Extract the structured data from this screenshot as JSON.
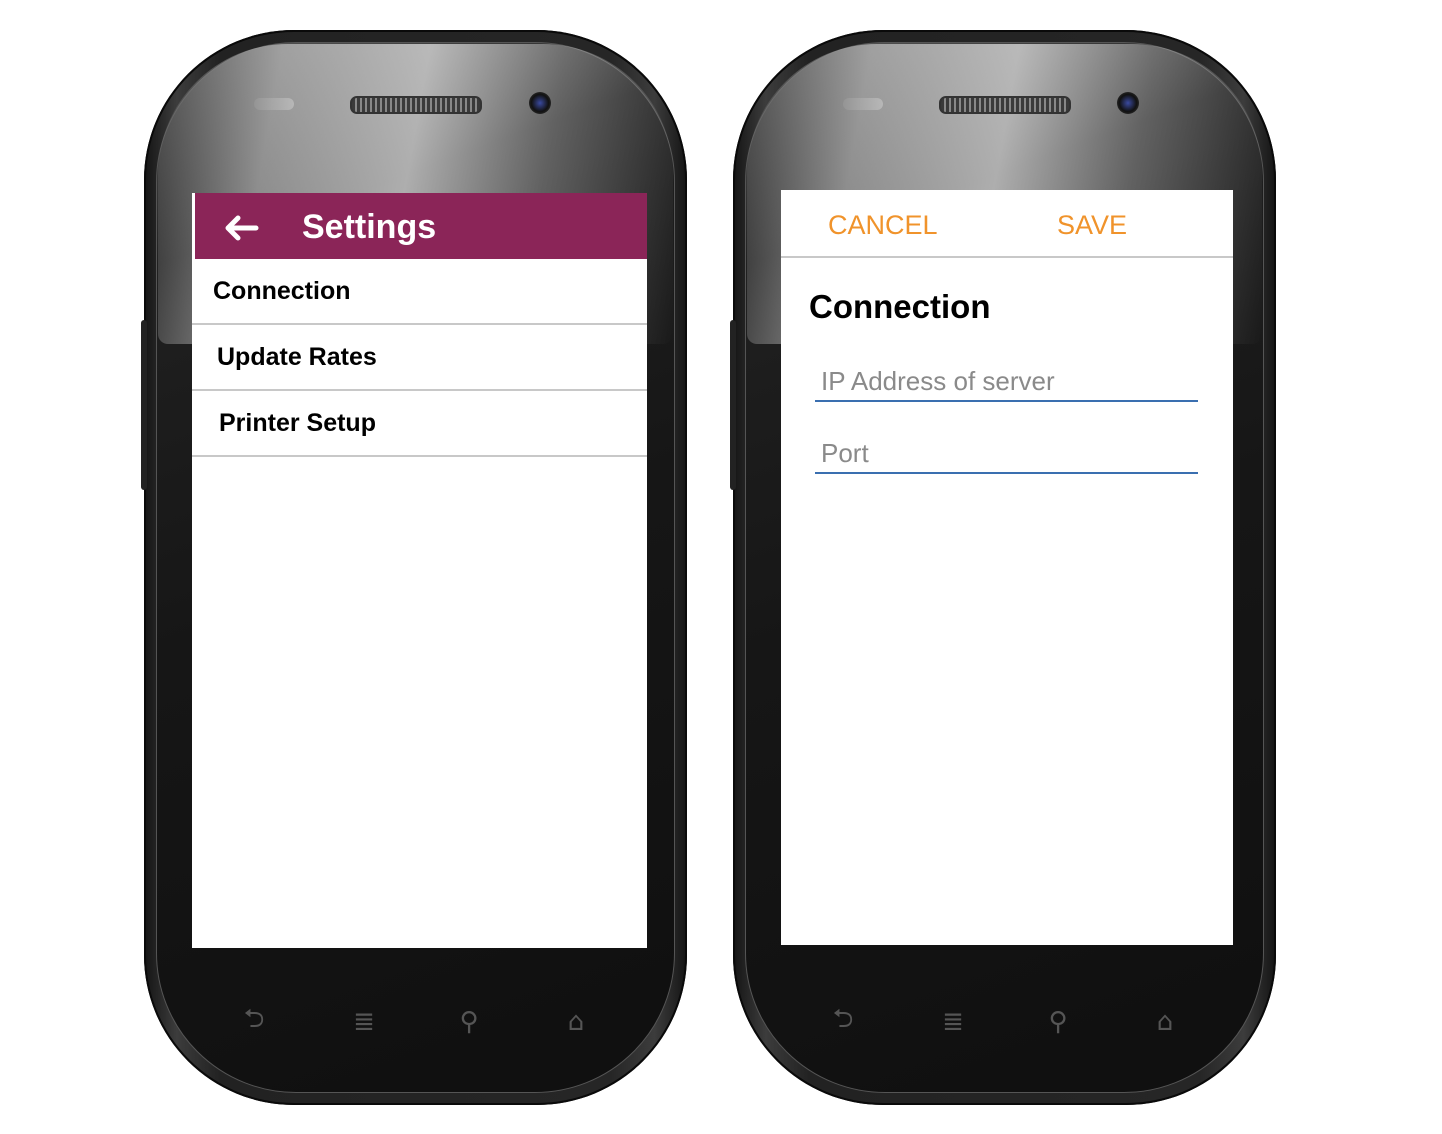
{
  "settings_screen": {
    "title": "Settings",
    "back_icon": "arrow-left-icon",
    "header_color": "#8b2558",
    "items": [
      {
        "label": "Connection"
      },
      {
        "label": "Update Rates"
      },
      {
        "label": "Printer Setup"
      }
    ]
  },
  "connection_screen": {
    "cancel_label": "CANCEL",
    "save_label": "SAVE",
    "accent_color": "#f0932b",
    "title": "Connection",
    "ip_field": {
      "placeholder": "IP Address of server",
      "value": ""
    },
    "port_field": {
      "placeholder": "Port",
      "value": ""
    }
  },
  "device_nav": {
    "icons": [
      "back-icon",
      "menu-icon",
      "search-icon",
      "home-icon"
    ]
  }
}
